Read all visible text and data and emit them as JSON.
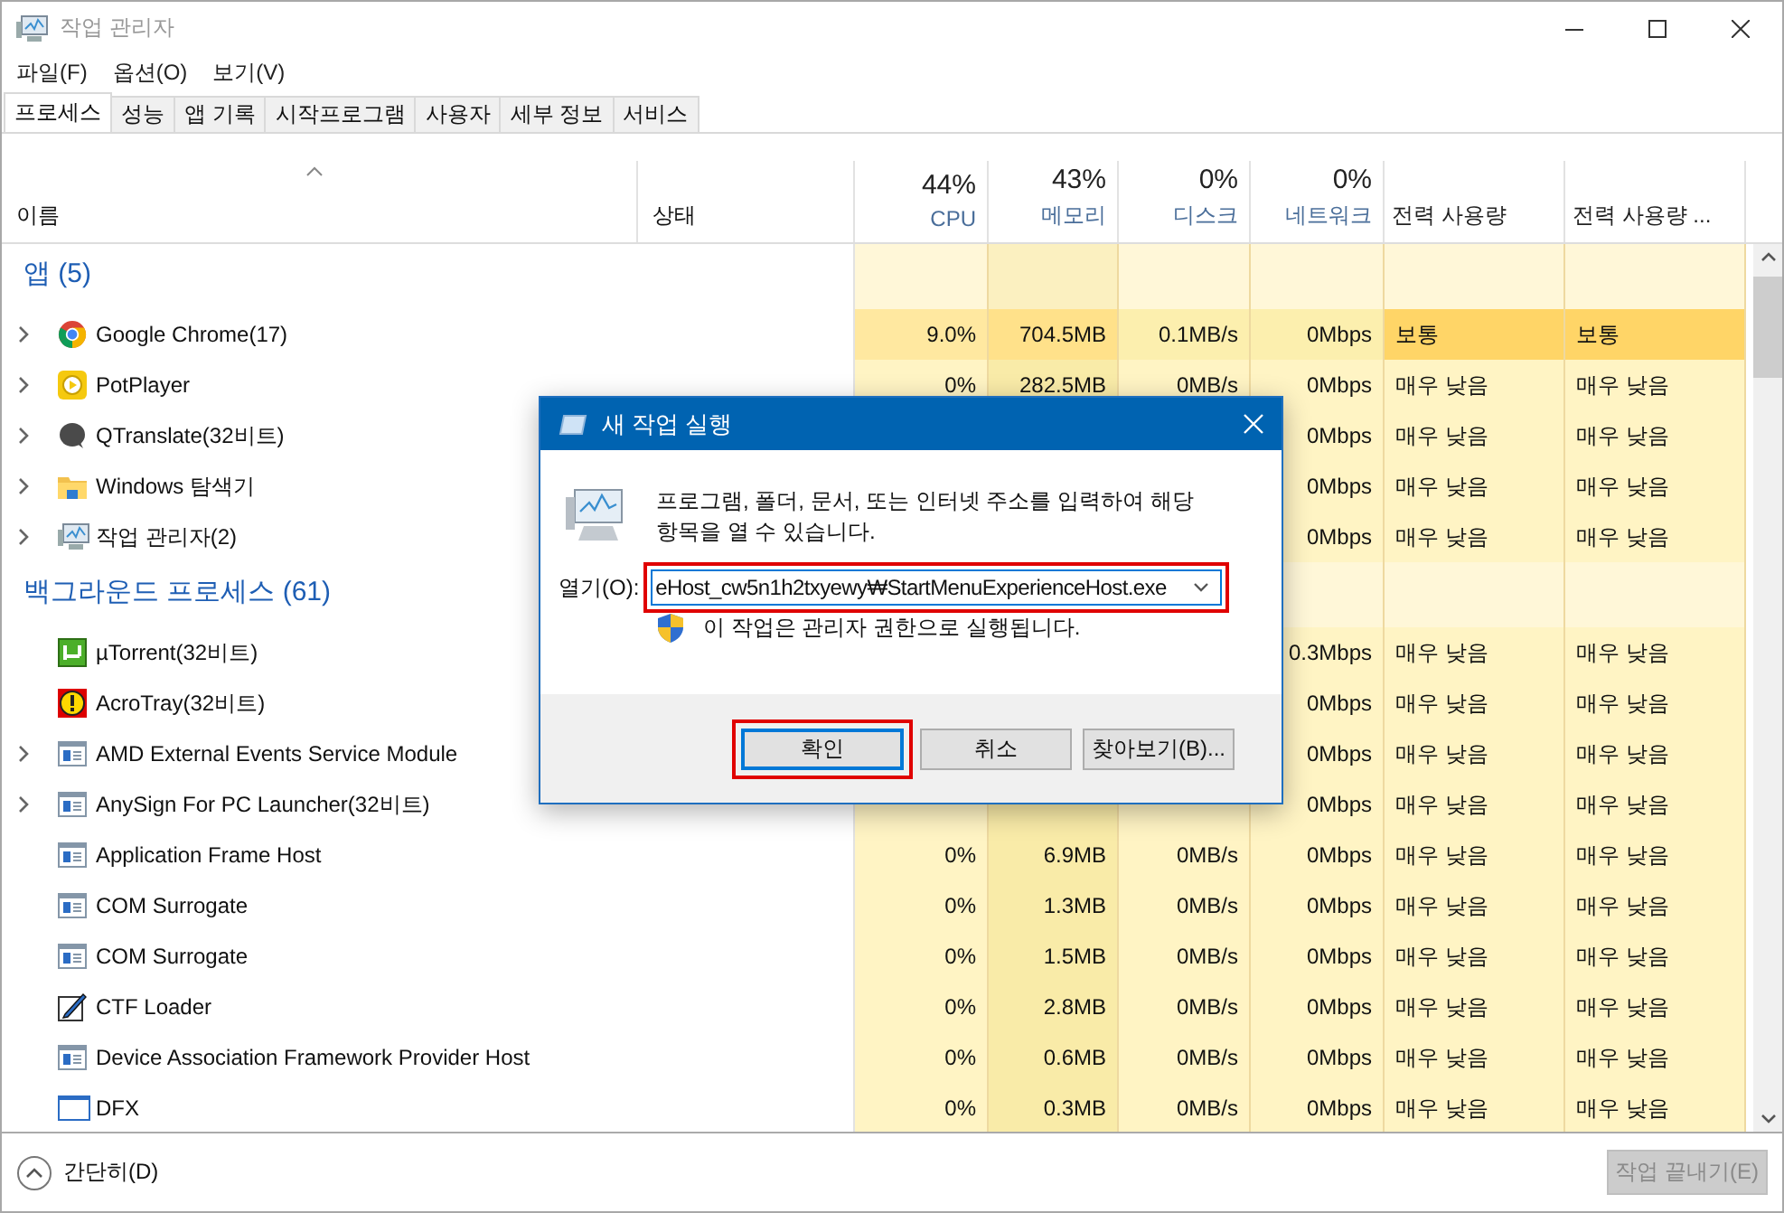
{
  "window": {
    "title": "작업 관리자"
  },
  "menu": [
    "파일(F)",
    "옵션(O)",
    "보기(V)"
  ],
  "tabs": [
    {
      "label": "프로세스",
      "selected": true
    },
    {
      "label": "성능",
      "selected": false
    },
    {
      "label": "앱 기록",
      "selected": false
    },
    {
      "label": "시작프로그램",
      "selected": false
    },
    {
      "label": "사용자",
      "selected": false
    },
    {
      "label": "세부 정보",
      "selected": false
    },
    {
      "label": "서비스",
      "selected": false
    }
  ],
  "table": {
    "columns": [
      {
        "label": "이름"
      },
      {
        "label": "상태"
      },
      {
        "total": "44%",
        "label": "CPU"
      },
      {
        "total": "43%",
        "label": "메모리"
      },
      {
        "total": "0%",
        "label": "디스크"
      },
      {
        "total": "0%",
        "label": "네트워크"
      },
      {
        "label": "전력 사용량"
      },
      {
        "label": "전력 사용량 ..."
      }
    ],
    "rows": [
      {
        "kind": "group",
        "label": "앱 (5)"
      },
      {
        "kind": "process",
        "name": "Google Chrome(17)",
        "expandable": true,
        "highlighted": true,
        "cpu": "9.0%",
        "memory": "704.5MB",
        "disk": "0.1MB/s",
        "network": "0Mbps",
        "power": "보통",
        "power_trend": "보통"
      },
      {
        "kind": "process",
        "name": "PotPlayer",
        "expandable": true,
        "highlighted": false,
        "cpu": "0%",
        "memory": "282.5MB",
        "disk": "0MB/s",
        "network": "0Mbps",
        "power": "매우 낮음",
        "power_trend": "매우 낮음"
      },
      {
        "kind": "process",
        "name": "QTranslate(32비트)",
        "expandable": true,
        "highlighted": false,
        "network": "0Mbps",
        "power": "매우 낮음",
        "power_trend": "매우 낮음"
      },
      {
        "kind": "process",
        "name": "Windows 탐색기",
        "expandable": true,
        "highlighted": false,
        "network": "0Mbps",
        "power": "매우 낮음",
        "power_trend": "매우 낮음"
      },
      {
        "kind": "process",
        "name": "작업 관리자(2)",
        "expandable": true,
        "highlighted": false,
        "network": "0Mbps",
        "power": "매우 낮음",
        "power_trend": "매우 낮음"
      },
      {
        "kind": "group",
        "label": "백그라운드 프로세스 (61)"
      },
      {
        "kind": "process",
        "name": "µTorrent(32비트)",
        "expandable": false,
        "highlighted": false,
        "network": "0.3Mbps",
        "power": "매우 낮음",
        "power_trend": "매우 낮음"
      },
      {
        "kind": "process",
        "name": "AcroTray(32비트)",
        "expandable": false,
        "highlighted": false,
        "network": "0Mbps",
        "power": "매우 낮음",
        "power_trend": "매우 낮음"
      },
      {
        "kind": "process",
        "name": "AMD External Events Service Module",
        "expandable": true,
        "highlighted": false,
        "network": "0Mbps",
        "power": "매우 낮음",
        "power_trend": "매우 낮음"
      },
      {
        "kind": "process",
        "name": "AnySign For PC Launcher(32비트)",
        "expandable": true,
        "highlighted": false,
        "network": "0Mbps",
        "power": "매우 낮음",
        "power_trend": "매우 낮음"
      },
      {
        "kind": "process",
        "name": "Application Frame Host",
        "expandable": false,
        "highlighted": false,
        "cpu": "0%",
        "memory": "6.9MB",
        "disk": "0MB/s",
        "network": "0Mbps",
        "power": "매우 낮음",
        "power_trend": "매우 낮음"
      },
      {
        "kind": "process",
        "name": "COM Surrogate",
        "expandable": false,
        "highlighted": false,
        "cpu": "0%",
        "memory": "1.3MB",
        "disk": "0MB/s",
        "network": "0Mbps",
        "power": "매우 낮음",
        "power_trend": "매우 낮음"
      },
      {
        "kind": "process",
        "name": "COM Surrogate",
        "expandable": false,
        "highlighted": false,
        "cpu": "0%",
        "memory": "1.5MB",
        "disk": "0MB/s",
        "network": "0Mbps",
        "power": "매우 낮음",
        "power_trend": "매우 낮음"
      },
      {
        "kind": "process",
        "name": "CTF Loader",
        "expandable": false,
        "highlighted": false,
        "cpu": "0%",
        "memory": "2.8MB",
        "disk": "0MB/s",
        "network": "0Mbps",
        "power": "매우 낮음",
        "power_trend": "매우 낮음"
      },
      {
        "kind": "process",
        "name": "Device Association Framework Provider Host",
        "expandable": false,
        "highlighted": false,
        "cpu": "0%",
        "memory": "0.6MB",
        "disk": "0MB/s",
        "network": "0Mbps",
        "power": "매우 낮음",
        "power_trend": "매우 낮음"
      },
      {
        "kind": "process",
        "name": "DFX",
        "expandable": false,
        "highlighted": false,
        "cpu": "0%",
        "memory": "0.3MB",
        "disk": "0MB/s",
        "network": "0Mbps",
        "power": "매우 낮음",
        "power_trend": "매우 낮음"
      }
    ]
  },
  "footer": {
    "toggle": "간단히(D)",
    "end_task": {
      "label": "작업 끝내기(E)",
      "disabled": true
    }
  },
  "dialog": {
    "title": "새 작업 실행",
    "message": "프로그램, 폴더, 문서, 또는 인터넷 주소를 입력하여 해당 항목을 열 수 있습니다.",
    "open_label": "열기(O):",
    "open_value": "eHost_cw5n1h2txyewy₩StartMenuExperienceHost.exe",
    "admin_note": "이 작업은 관리자 권한으로 실행됩니다.",
    "buttons": [
      {
        "label": "확인",
        "focused": true,
        "highlighted": true
      },
      {
        "label": "취소",
        "focused": false,
        "highlighted": false
      },
      {
        "label": "찾아보기(B)...",
        "focused": false,
        "highlighted": false
      }
    ],
    "field_highlighted": true
  }
}
